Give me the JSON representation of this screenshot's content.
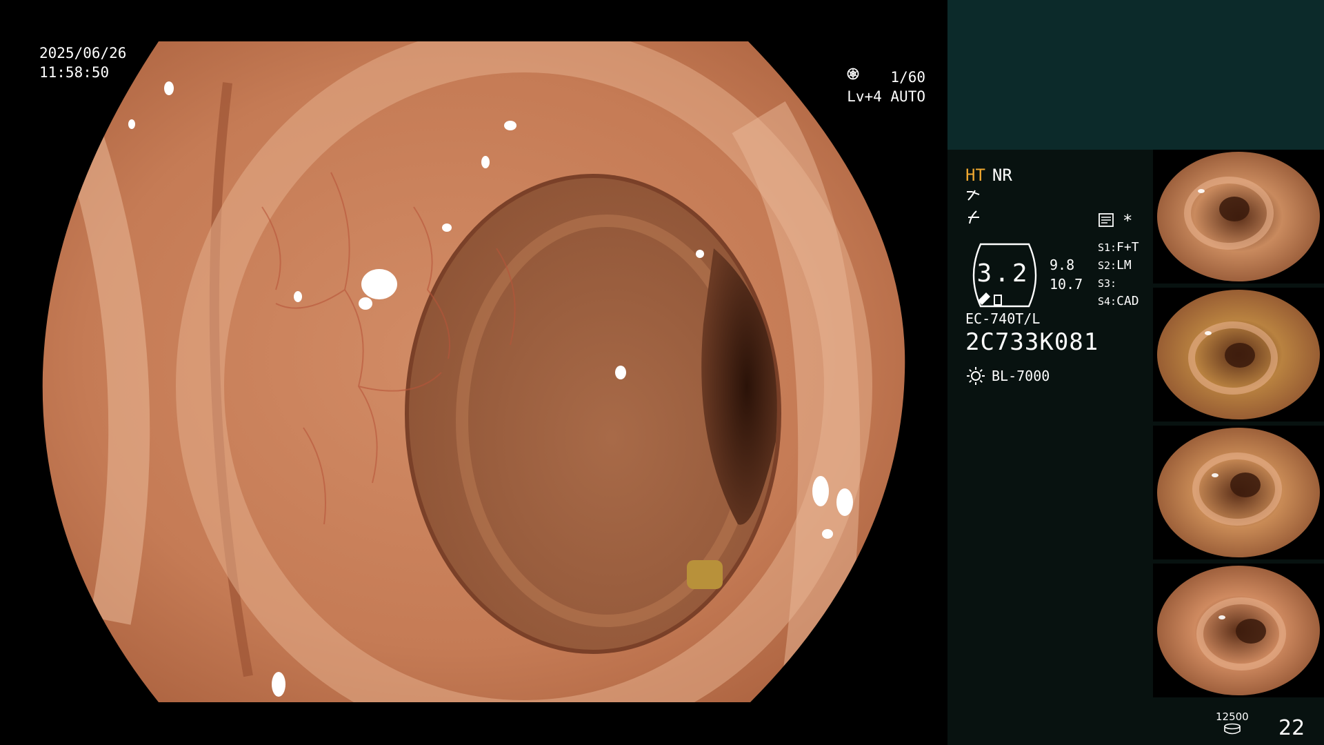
{
  "overlay": {
    "date": "2025/06/26",
    "time": "11:58:50",
    "shutter": "1/60",
    "shutter_icon": "aperture-icon",
    "level": "Lv+4 AUTO",
    "level_icon": "auto-iris-icon"
  },
  "status": {
    "mode_ht": "HT",
    "mode_nr": "NR",
    "edge_icon": "edge-enhance-icon",
    "contrast_icon": "contrast-icon",
    "settings_icon": "settings-icon",
    "star": "*",
    "zoom": "3.2",
    "focus_1": "9.8",
    "focus_2": "10.7",
    "slots": [
      {
        "key": "S1:",
        "value": "F+T"
      },
      {
        "key": "S2:",
        "value": "LM"
      },
      {
        "key": "S3:",
        "value": ""
      },
      {
        "key": "S4:",
        "value": "CAD"
      }
    ],
    "scope_model": "EC-740T/L",
    "serial": "2C733K081",
    "light_source": "BL-7000",
    "light_icon": "light-source-icon"
  },
  "thumbnails": [
    {
      "label": "capture-1",
      "tone": "#c98a5e"
    },
    {
      "label": "capture-2",
      "tone": "#b98240"
    },
    {
      "label": "capture-3",
      "tone": "#c98b56"
    },
    {
      "label": "capture-4",
      "tone": "#cf8a60"
    }
  ],
  "footer": {
    "storage_count": "12500",
    "page_count": "22"
  },
  "colors": {
    "mucosa": "#c57b55",
    "ht_accent": "#f0a830",
    "panel_bg": "#081210",
    "top_band": "#0c2a2a"
  }
}
